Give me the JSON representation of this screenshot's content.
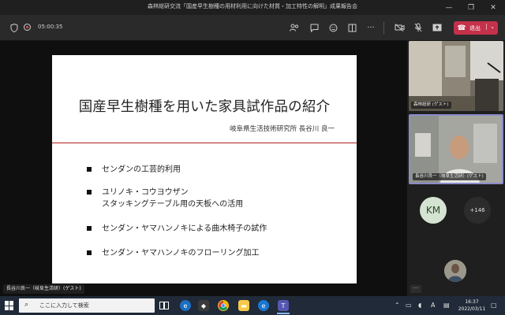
{
  "window": {
    "title": "森林総研交流「国産早生樹種の用材利用に向けた材質・加工特性の解明」成果報告会",
    "controls": {
      "minimize": "—",
      "restore": "❐",
      "close": "✕"
    }
  },
  "toolbar": {
    "timer": "05:00:35",
    "leave_label": "退出",
    "icons": [
      "shield-icon",
      "record-icon",
      "participants-icon",
      "chat-icon",
      "reactions-icon",
      "rooms-icon",
      "more-icon",
      "camera-off-icon",
      "mic-icon",
      "share-icon",
      "phone-icon"
    ]
  },
  "slide": {
    "title": "国産早生樹種を用いた家具試作品の紹介",
    "subtitle": "岐阜県生活技術研究所 長谷川 良一",
    "bullets": [
      [
        "センダンの工芸的利用"
      ],
      [
        "ユリノキ・コウヨウザン",
        "スタッキングテーブル用の天板への活用"
      ],
      [
        "センダン・ヤマハンノキによる曲木椅子の試作"
      ],
      [
        "センダン・ヤマハンノキのフローリング加工"
      ]
    ],
    "accent_color": "#b32020"
  },
  "stage": {
    "speaker_label": "長谷川良一（岐阜生活研）(ゲスト)"
  },
  "participants": {
    "tile1_label": "森林総研 (ゲスト)",
    "tile2_label": "長谷川良一（岐阜生活研）(ゲスト)",
    "initials": "KM",
    "overflow": "+146",
    "more": "···"
  },
  "taskbar": {
    "search_placeholder": "ここに入力して検索",
    "time": "16:37",
    "date": "2022/03/11"
  }
}
